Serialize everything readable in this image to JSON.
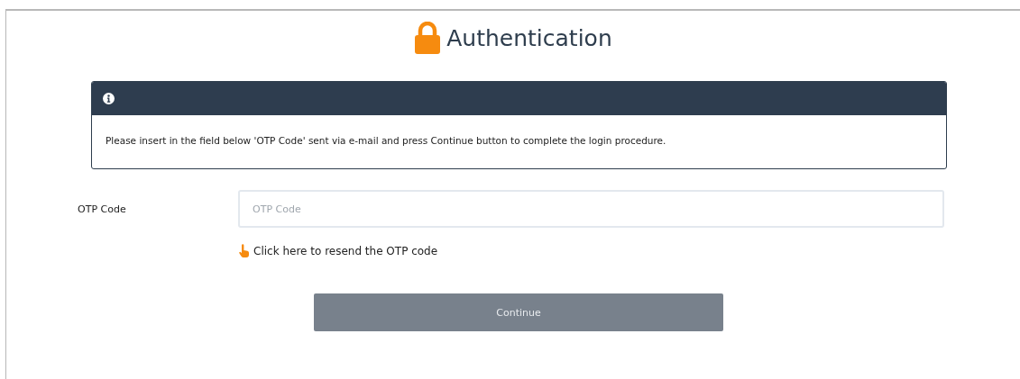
{
  "title": "Authentication",
  "notice": {
    "message": "Please insert in the field below 'OTP Code' sent via e-mail and press Continue button to complete the login procedure."
  },
  "otp_field": {
    "label": "OTP Code",
    "placeholder": "OTP Code"
  },
  "resend_link": "Click here to resend the OTP code",
  "continue_button": {
    "label": "Continue",
    "disabled": true
  }
}
